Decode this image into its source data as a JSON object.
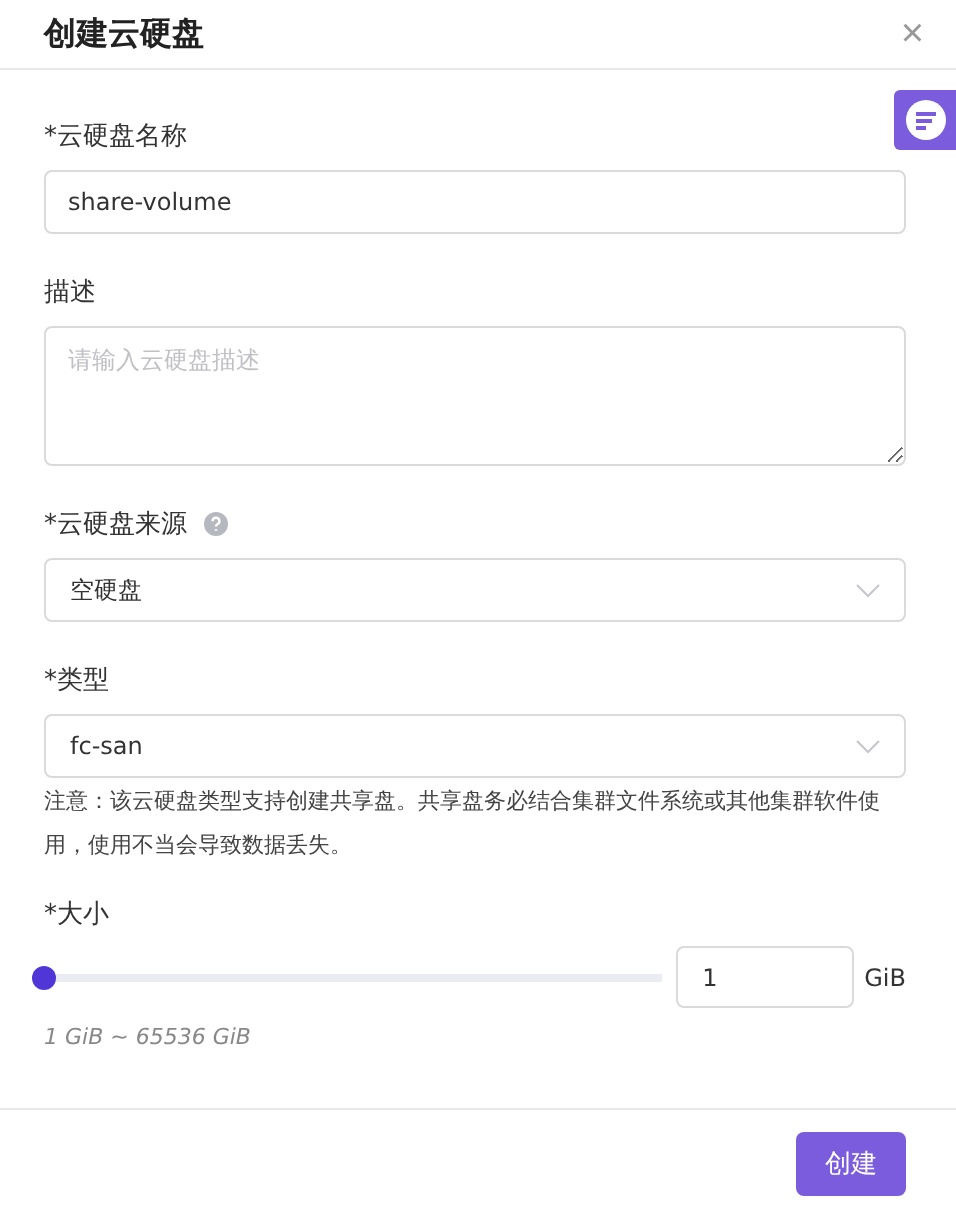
{
  "dialog": {
    "title": "创建云硬盘",
    "close": "×"
  },
  "fields": [
    {
      "kind": "text",
      "label": "*云硬盘名称",
      "value": "share-volume"
    },
    {
      "kind": "textarea",
      "label": "描述",
      "placeholder": "请输入云硬盘描述"
    },
    {
      "kind": "select",
      "label": "*云硬盘来源",
      "help": true,
      "value": "空硬盘"
    },
    {
      "kind": "select",
      "label": "*类型",
      "help": false,
      "value": "fc-san",
      "note": "注意：该云硬盘类型支持创建共享盘。共享盘务必结合集群文件系统或其他集群软件使用，使用不当会导致数据丢失。"
    },
    {
      "kind": "slider",
      "label": "*大小",
      "level": 0,
      "value": "1",
      "unit": "GiB",
      "hint": "1 GiB ~ 65536 GiB"
    }
  ],
  "buttons": [
    {
      "label": "创建"
    }
  ]
}
